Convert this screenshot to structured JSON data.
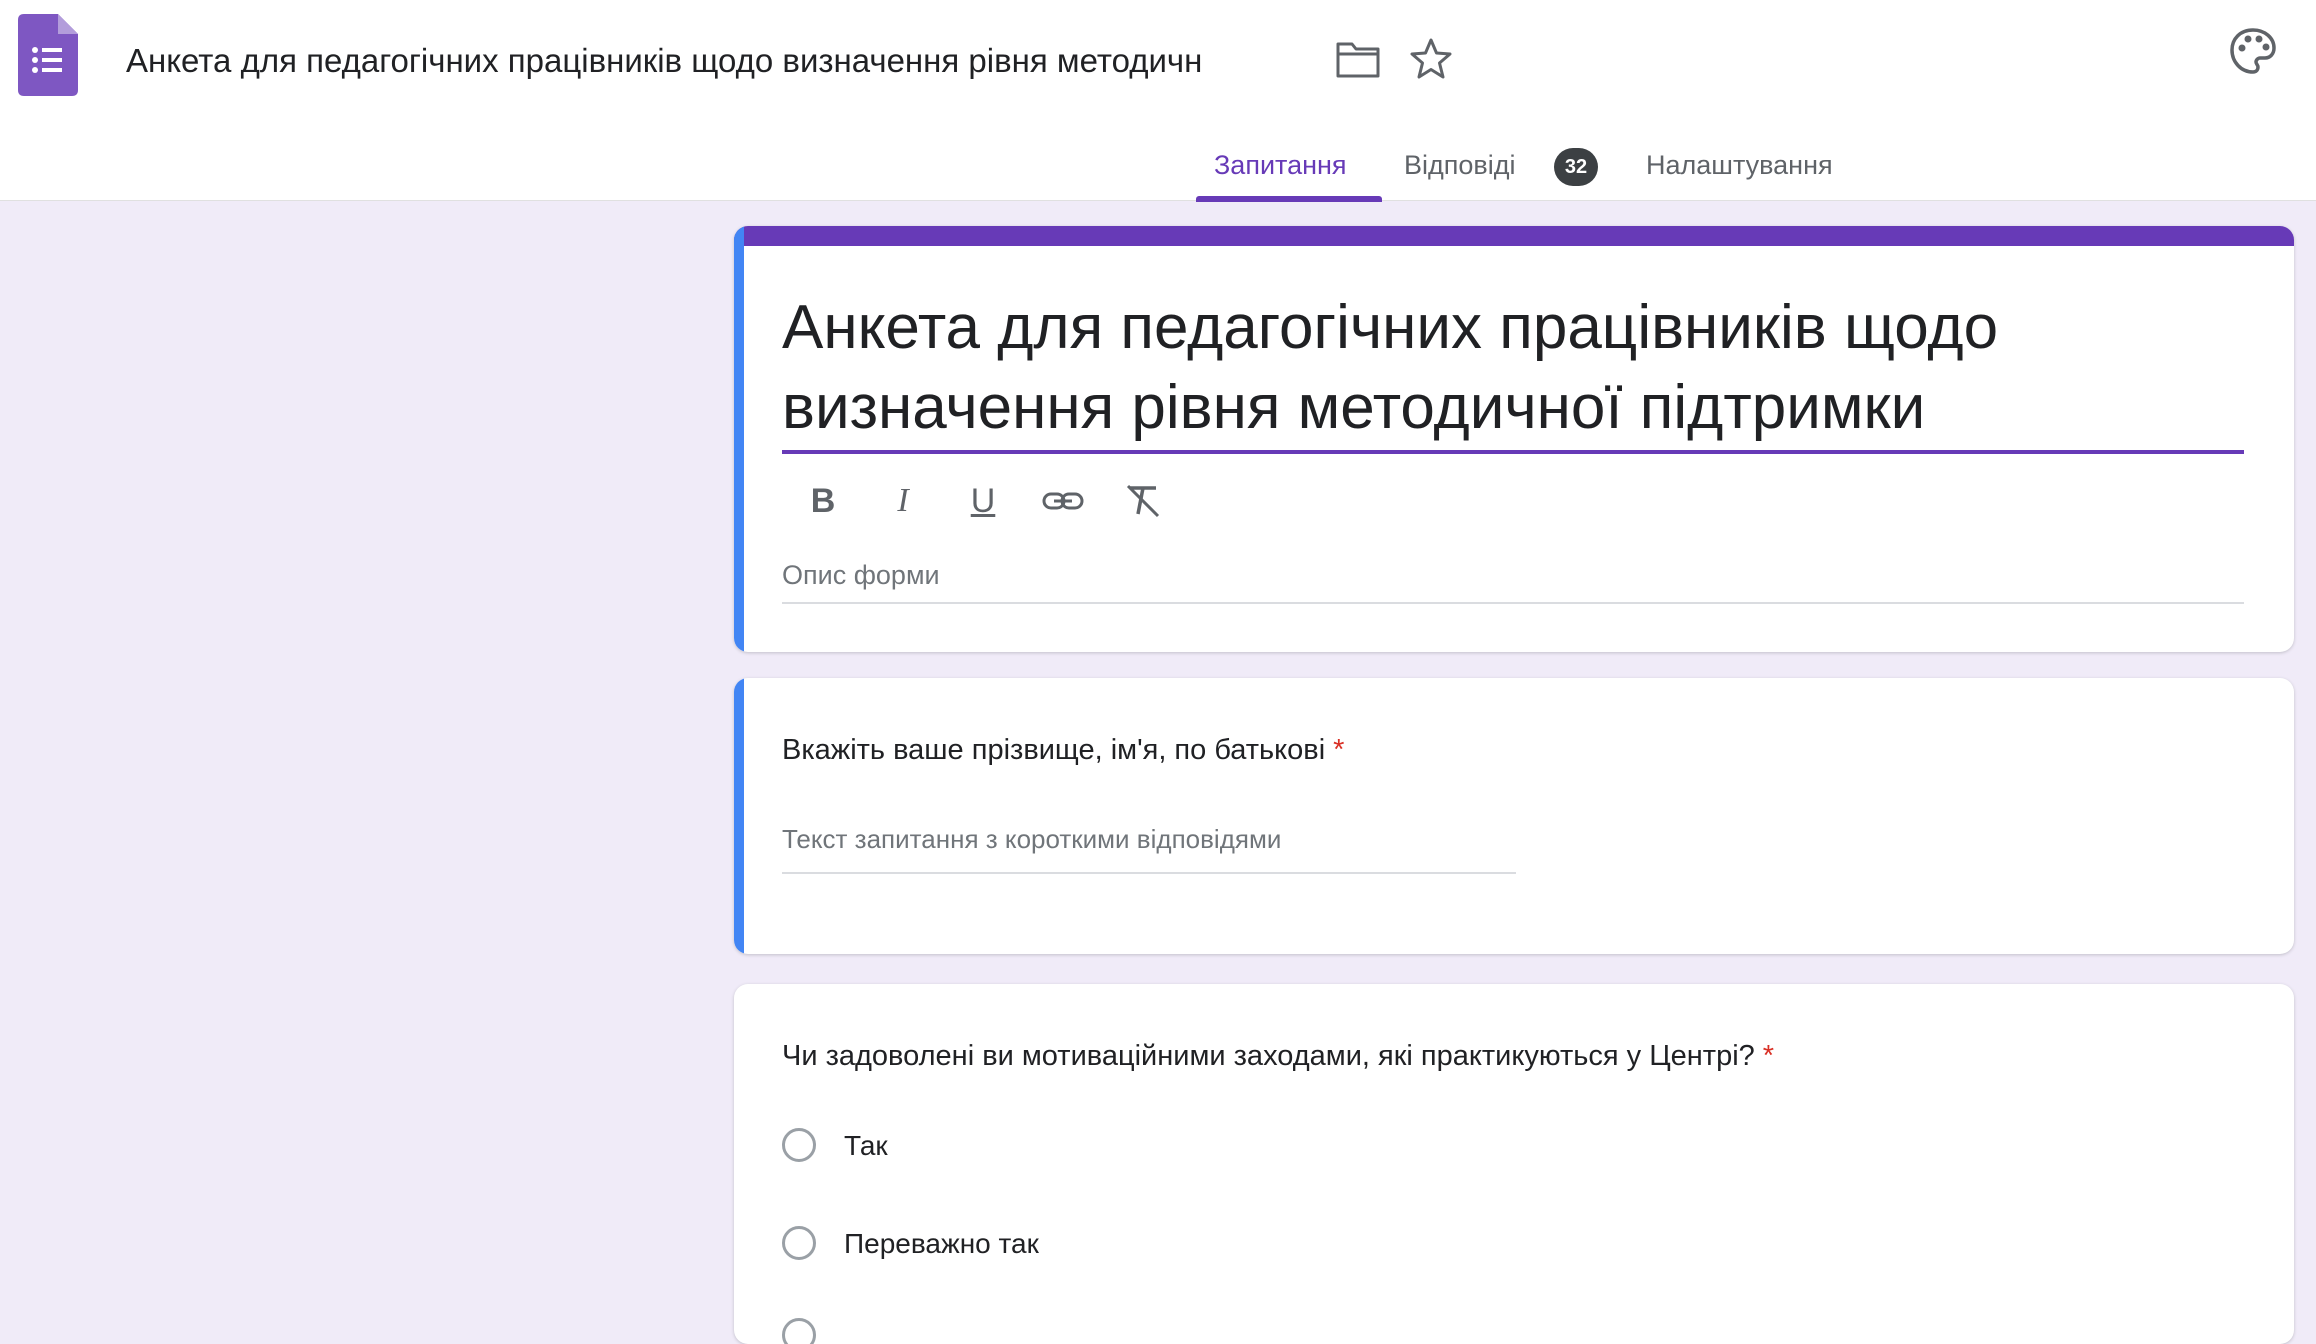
{
  "header": {
    "doc_title": "Анкета для педагогічних працівників щодо визначення рівня методичн",
    "app_icon": "google-forms-icon",
    "folder_icon": "folder-icon",
    "star_icon": "star-icon",
    "palette_icon": "palette-icon"
  },
  "tabs": [
    {
      "label": "Запитання",
      "active": true
    },
    {
      "label": "Відповіді",
      "active": false
    },
    {
      "label": "Налаштування",
      "active": false
    }
  ],
  "responses_badge": "32",
  "colors": {
    "accent": "#673ab7",
    "focus_bar": "#4285f4",
    "background": "#f0ebf8",
    "required": "#d93025"
  },
  "form": {
    "title_line1": "Анкета для педагогічних працівників щодо",
    "title_line2": "визначення рівня методичної підтримки",
    "toolbar": {
      "bold": "B",
      "italic": "I",
      "underline": "U",
      "link_icon": "link-icon",
      "clear_format_icon": "clear-format-icon"
    },
    "description_placeholder": "Опис форми"
  },
  "questions": [
    {
      "text": "Вкажіть ваше прізвище, ім'я, по батькові",
      "required_mark": "*",
      "type": "short-answer",
      "placeholder": "Текст запитання з короткими відповідями"
    },
    {
      "text": "Чи задоволені ви мотиваційними заходами, які практикуються у Центрі?",
      "required_mark": "*",
      "type": "multiple-choice",
      "options": [
        "Так",
        "Переважно так"
      ]
    }
  ]
}
